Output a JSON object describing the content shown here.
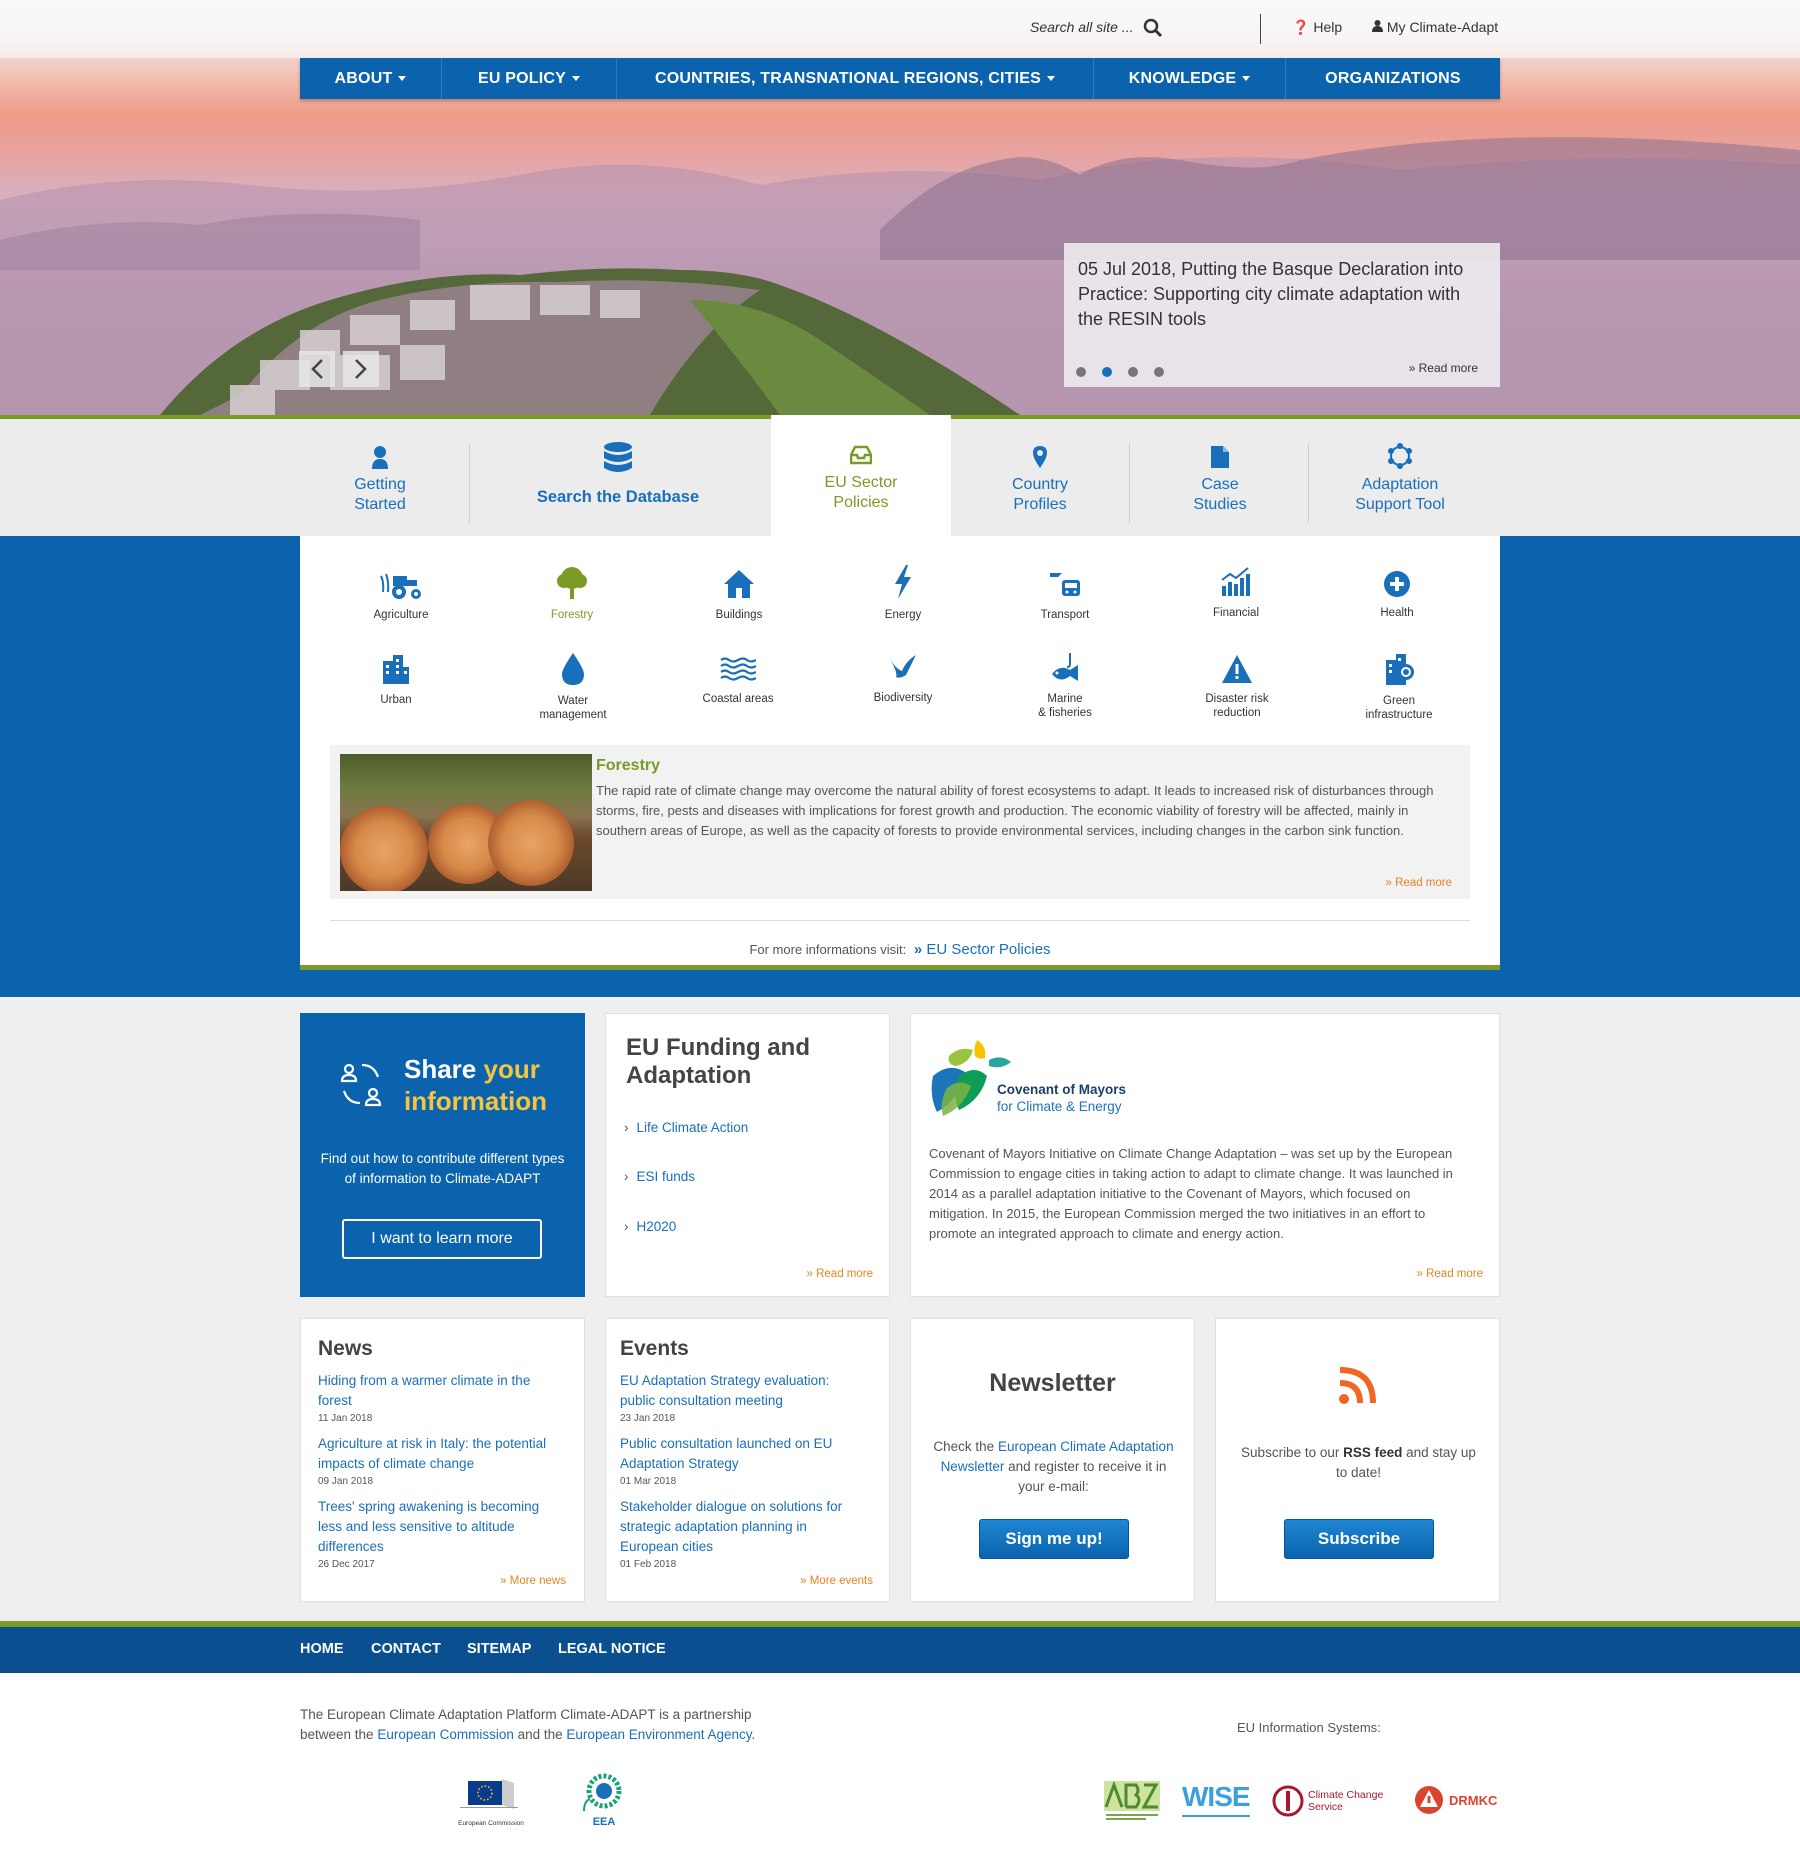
{
  "header": {
    "search_placeholder": "Search all site ...",
    "help": "Help",
    "my_account": "My Climate-Adapt"
  },
  "nav": [
    "ABOUT",
    "EU POLICY",
    "COUNTRIES, TRANSNATIONAL REGIONS, CITIES",
    "KNOWLEDGE",
    "ORGANIZATIONS"
  ],
  "slider": {
    "title": "05 Jul 2018, Putting the Basque Declaration into Practice: Supporting city climate adaptation with the RESIN tools",
    "read_more": "Read more",
    "active_dot": 2
  },
  "tabs": [
    {
      "label1": "Getting",
      "label2": "Started",
      "icon": "user-icon"
    },
    {
      "label1": "Search the Database",
      "label2": "",
      "icon": "database-icon"
    },
    {
      "label1": "EU Sector",
      "label2": "Policies",
      "icon": "inbox-icon"
    },
    {
      "label1": "Country",
      "label2": "Profiles",
      "icon": "map-marker-icon"
    },
    {
      "label1": "Case",
      "label2": "Studies",
      "icon": "document-icon"
    },
    {
      "label1": "Adaptation",
      "label2": "Support Tool",
      "icon": "cycle-icon"
    }
  ],
  "sectors": [
    {
      "l1": "Agriculture",
      "l2": "",
      "icon": "tractor-icon"
    },
    {
      "l1": "Forestry",
      "l2": "",
      "icon": "tree-icon"
    },
    {
      "l1": "Buildings",
      "l2": "",
      "icon": "house-icon"
    },
    {
      "l1": "Energy",
      "l2": "",
      "icon": "lightning-icon"
    },
    {
      "l1": "Transport",
      "l2": "",
      "icon": "transport-icon"
    },
    {
      "l1": "Financial",
      "l2": "",
      "icon": "chart-icon"
    },
    {
      "l1": "Health",
      "l2": "",
      "icon": "health-icon"
    },
    {
      "l1": "Urban",
      "l2": "",
      "icon": "building-icon"
    },
    {
      "l1": "Water",
      "l2": "management",
      "icon": "drop-icon"
    },
    {
      "l1": "Coastal areas",
      "l2": "",
      "icon": "waves-icon"
    },
    {
      "l1": "Biodiversity",
      "l2": "",
      "icon": "bird-icon"
    },
    {
      "l1": "Marine",
      "l2": "& fisheries",
      "icon": "fish-icon"
    },
    {
      "l1": "Disaster risk",
      "l2": "reduction",
      "icon": "warning-icon"
    },
    {
      "l1": "Green",
      "l2": "infrastructure",
      "icon": "green-infra-icon"
    }
  ],
  "feature": {
    "title": "Forestry",
    "text": "The rapid rate of climate change may overcome the natural ability of forest ecosystems to adapt. It leads to increased risk of disturbances through storms, fire, pests and diseases with implications for forest growth and production. The economic viability of forestry will be affected, mainly in southern areas of Europe, as well as the capacity of forests to provide environmental services, including changes in the carbon sink function.",
    "read_more": "Read more"
  },
  "visit": {
    "text": "For more informations visit:",
    "link": "EU Sector Policies"
  },
  "share": {
    "title1": "Share ",
    "title1b": "your",
    "title2": "information",
    "text": "Find out how to contribute different types of information to Climate-ADAPT",
    "button": "I want to learn more"
  },
  "funding": {
    "title": "EU Funding and Adaptation",
    "links": [
      "Life Climate Action",
      "ESI funds",
      "H2020"
    ],
    "read_more": "Read more"
  },
  "covenant": {
    "logo_line1": "Covenant of Mayors",
    "logo_line2": "for Climate & Energy",
    "text": "Covenant of Mayors Initiative on Climate Change Adaptation – was set up by the European Commission to engage cities in taking action to adapt to climate change. It was launched in 2014 as a parallel adaptation initiative to the Covenant of Mayors, which focused on mitigation. In 2015, the European Commission merged the two initiatives in an effort to promote an integrated approach to climate and energy action.",
    "read_more": "Read more"
  },
  "news": {
    "title": "News",
    "items": [
      {
        "title": "Hiding from a warmer climate in the forest",
        "date": "11 Jan 2018"
      },
      {
        "title": "Agriculture at risk in Italy: the potential impacts of climate change",
        "date": "09 Jan 2018"
      },
      {
        "title": "Trees' spring awakening is becoming less and less sensitive to altitude differences",
        "date": "26 Dec 2017"
      }
    ],
    "more": "More news"
  },
  "events": {
    "title": "Events",
    "items": [
      {
        "title": "EU Adaptation  Strategy evaluation: public consultation meeting",
        "date": "23 Jan 2018"
      },
      {
        "title": "Public consultation launched on EU Adaptation Strategy",
        "date": "01 Mar 2018"
      },
      {
        "title": "Stakeholder dialogue on solutions for strategic adaptation planning in European cities",
        "date": "01 Feb 2018"
      }
    ],
    "more": "More events"
  },
  "newsletter": {
    "title": "Newsletter",
    "pre": "Check the ",
    "link": "European Climate Adaptation Newsletter",
    "post": " and register to receive it in your e-mail:",
    "button": "Sign me up!"
  },
  "rss": {
    "pre": "Subscribe to our ",
    "bold": "RSS feed",
    "post": " and stay up to date!",
    "button": "Subscribe"
  },
  "footer_nav": [
    "HOME",
    "CONTACT",
    "SITEMAP",
    "LEGAL NOTICE"
  ],
  "footer": {
    "text_pre": "The European Climate Adaptation Platform Climate-ADAPT is a partnership between the ",
    "link1": "European Commission",
    "mid": " and the ",
    "link2": "European Environment Agency",
    "end": ".",
    "eu_systems": "EU Information Systems:",
    "logo_ec": "European Commission",
    "logo_eea": "EEA",
    "logo_wise": "WISE",
    "logo_cc1": "Climate Change",
    "logo_cc2": "Service",
    "logo_drmkc": "DRMKC"
  },
  "colors": {
    "brand_blue": "#0a63ac",
    "green": "#7a9b25",
    "orange": "#e8831e",
    "link": "#1a6fbb"
  }
}
